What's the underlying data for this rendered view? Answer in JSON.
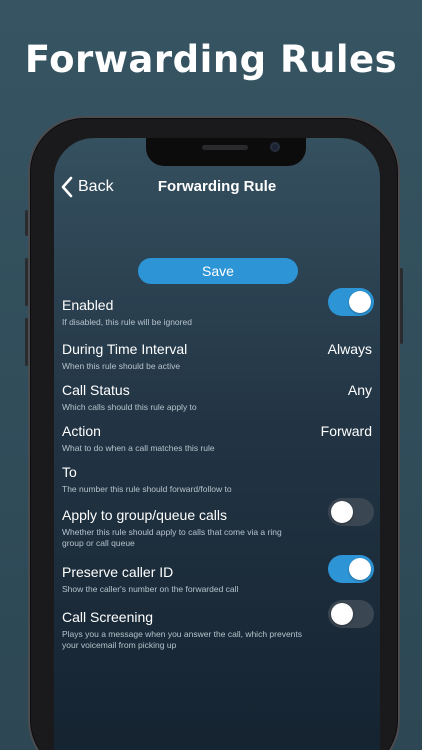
{
  "banner": {
    "title": "Forwarding Rules"
  },
  "nav": {
    "back_label": "Back",
    "title": "Forwarding Rule"
  },
  "save_label": "Save",
  "colors": {
    "accent": "#2d95d6",
    "toggle_off": "#3a4651"
  },
  "rows": [
    {
      "title": "Enabled",
      "subtitle": "If disabled, this rule will be ignored",
      "control": "toggle",
      "on": true
    },
    {
      "title": "During Time Interval",
      "subtitle": "When this rule should be active",
      "control": "value",
      "value": "Always"
    },
    {
      "title": "Call Status",
      "subtitle": "Which calls should this rule apply to",
      "control": "value",
      "value": "Any"
    },
    {
      "title": "Action",
      "subtitle": "What to do when a call matches this rule",
      "control": "value",
      "value": "Forward"
    },
    {
      "title": "To",
      "subtitle": "The number this rule should forward/follow to",
      "control": "value",
      "value": ""
    },
    {
      "title": "Apply to group/queue calls",
      "subtitle": "Whether this rule should apply to calls that come via a ring group or call queue",
      "control": "toggle",
      "on": false
    },
    {
      "title": "Preserve caller ID",
      "subtitle": "Show the caller's number on the forwarded call",
      "control": "toggle",
      "on": true
    },
    {
      "title": "Call Screening",
      "subtitle": "Plays you a message when you answer the call, which prevents your voicemail from picking up",
      "control": "toggle",
      "on": false
    }
  ]
}
